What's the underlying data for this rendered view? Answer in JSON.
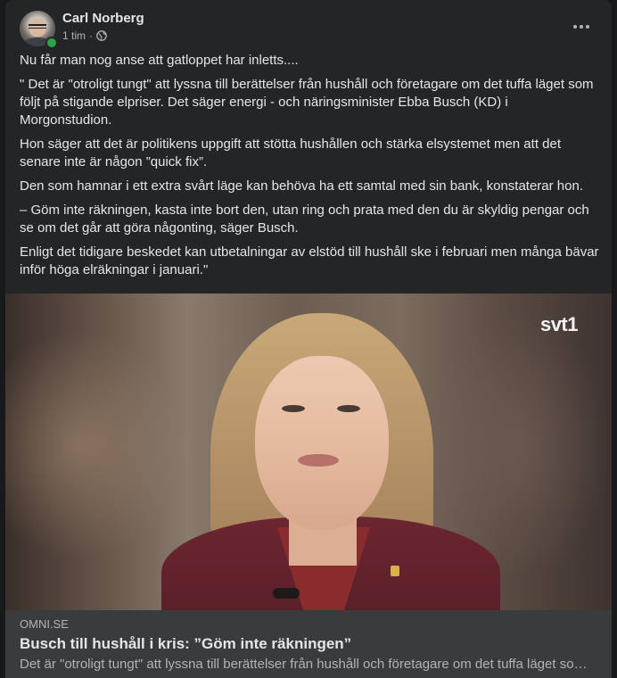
{
  "post": {
    "author": "Carl Norberg",
    "time": "1 tim",
    "separator": "·",
    "audience_icon": "globe-icon",
    "more_icon": "more-horizontal-icon",
    "paragraphs": [
      "Nu får man nog anse att gatloppet har inletts....",
      "\" Det är \"otroligt tungt\" att lyssna till berättelser från hushåll och företagare om det tuffa läget som följt på stigande elpriser. Det säger energi - och näringsminister Ebba Busch (KD) i Morgonstudion.",
      "Hon säger att det är politikens uppgift att stötta hushållen och stärka elsystemet men att det senare inte är någon ”quick fix”.",
      "Den som hamnar i ett extra svårt läge kan behöva ha ett samtal med sin bank, konstaterar hon.",
      "– Göm inte räkningen, kasta inte bort den, utan ring och prata med den du är skyldig pengar och se om det går att göra någonting, säger Busch.",
      "Enligt det tidigare beskedet kan utbetalningar av elstöd till hushåll ske i februari men många bävar inför höga elräkningar i januari.\""
    ]
  },
  "media": {
    "channel_logo": "svt1"
  },
  "link": {
    "domain": "OMNI.SE",
    "title": "Busch till hushåll i kris: ”Göm inte räkningen”",
    "description": "Det är \"otroligt tungt\" att lyssna till berättelser från hushåll och företagare om det tuffa läget som följt på stigande elpriser."
  },
  "colors": {
    "card_bg": "#242526",
    "page_bg": "#18191a",
    "text_primary": "#e4e6eb",
    "text_secondary": "#b0b3b8",
    "online": "#31a24c",
    "link_bg": "#3a3b3c"
  }
}
